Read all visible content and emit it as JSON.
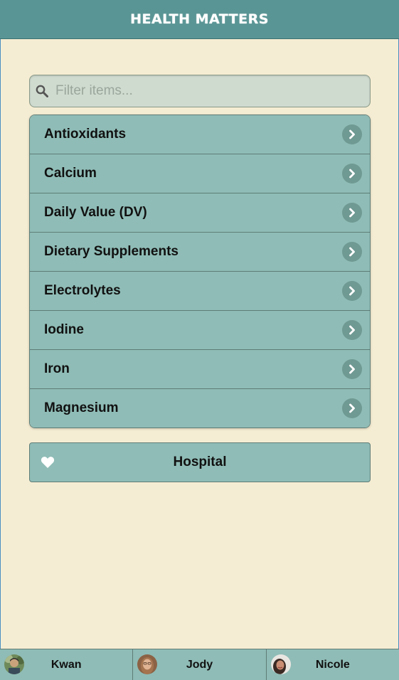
{
  "header": {
    "title": "Health Matters"
  },
  "search": {
    "placeholder": "Filter items...",
    "value": ""
  },
  "topics": [
    {
      "label": "Antioxidants"
    },
    {
      "label": "Calcium"
    },
    {
      "label": "Daily Value (DV)"
    },
    {
      "label": "Dietary Supplements"
    },
    {
      "label": "Electrolytes"
    },
    {
      "label": "Iodine"
    },
    {
      "label": "Iron"
    },
    {
      "label": "Magnesium"
    }
  ],
  "hospital_button": {
    "label": "Hospital",
    "icon": "heart-icon"
  },
  "footer": {
    "tabs": [
      {
        "label": "Kwan",
        "avatar": "kwan-avatar"
      },
      {
        "label": "Jody",
        "avatar": "jody-avatar"
      },
      {
        "label": "Nicole",
        "avatar": "nicole-avatar"
      }
    ]
  },
  "colors": {
    "header_bg": "#5a9595",
    "page_bg": "#f5edd3",
    "list_bg": "#8fbcb6",
    "search_bg": "#d0dbd0",
    "chevron_bg": "#6f9993"
  }
}
